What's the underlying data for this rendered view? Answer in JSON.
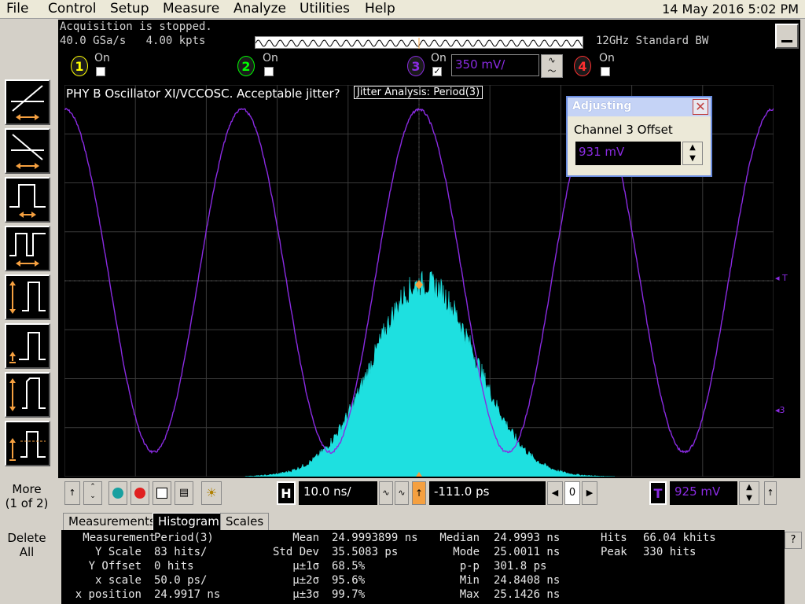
{
  "menu": {
    "items": [
      "File",
      "Control",
      "Setup",
      "Measure",
      "Analyze",
      "Utilities",
      "Help"
    ],
    "datetime": "14 May 2016  5:02 PM"
  },
  "status": {
    "acq_state": "Acquisition is stopped.",
    "sample_rate": "40.0 GSa/s",
    "memory_depth": "4.00 kpts",
    "bandwidth": "12GHz Standard BW"
  },
  "channels": [
    {
      "num": "1",
      "on_label": "On",
      "checked": false,
      "color": "#ffff00"
    },
    {
      "num": "2",
      "on_label": "On",
      "checked": false,
      "color": "#00ff00"
    },
    {
      "num": "3",
      "on_label": "On",
      "checked": true,
      "color": "#8a2be2",
      "scale": "350 mV/"
    },
    {
      "num": "4",
      "on_label": "On",
      "checked": false,
      "color": "#ff3030"
    }
  ],
  "waveform": {
    "title": "PHY B Oscillator XI/VCCOSC. Acceptable jitter?",
    "analysis_tag": "Jitter Analysis: Period(3)",
    "ref_marker_T": "T",
    "ref_marker_3": "3",
    "trace_color": "#8a2be2",
    "hist_color": "#1ee0e0"
  },
  "adjusting": {
    "title": "Adjusting",
    "label": "Channel 3 Offset",
    "value": "931 mV"
  },
  "side": {
    "more_label": "More",
    "more_sub": "(1 of 2)",
    "delete_label": "Delete",
    "delete_sub": "All"
  },
  "controls": {
    "horiz_label": "H",
    "timebase": "10.0 ns/",
    "delay": "-111.0 ps",
    "ref_count": "0",
    "trig_label": "T",
    "trig_level": "925 mV"
  },
  "tabs": [
    "Measurements",
    "Histogram",
    "Scales"
  ],
  "active_tab": "Histogram",
  "results": {
    "measurement_label": "Measurement",
    "measurement_value": "Period(3)",
    "yscale_label": "Y Scale",
    "yscale_value": "83 hits/",
    "yoffset_label": "Y Offset",
    "yoffset_value": "0 hits",
    "xscale_label": "x scale",
    "xscale_value": "50.0 ps/",
    "xpos_label": "x position",
    "xpos_value": "24.9917 ns",
    "mean_label": "Mean",
    "mean_value": "24.9993899 ns",
    "stddev_label": "Std Dev",
    "stddev_value": "35.5083 ps",
    "s1_label": "μ±1σ",
    "s1_value": "68.5%",
    "s2_label": "μ±2σ",
    "s2_value": "95.6%",
    "s3_label": "μ±3σ",
    "s3_value": "99.7%",
    "median_label": "Median",
    "median_value": "24.9993 ns",
    "mode_label": "Mode",
    "mode_value": "25.0011 ns",
    "pp_label": "p-p",
    "pp_value": "301.8 ps",
    "min_label": "Min",
    "min_value": "24.8408 ns",
    "max_label": "Max",
    "max_value": "25.1426 ns",
    "hits_label": "Hits",
    "hits_value": "66.04 khits",
    "peak_label": "Peak",
    "peak_value": "330 hits"
  }
}
